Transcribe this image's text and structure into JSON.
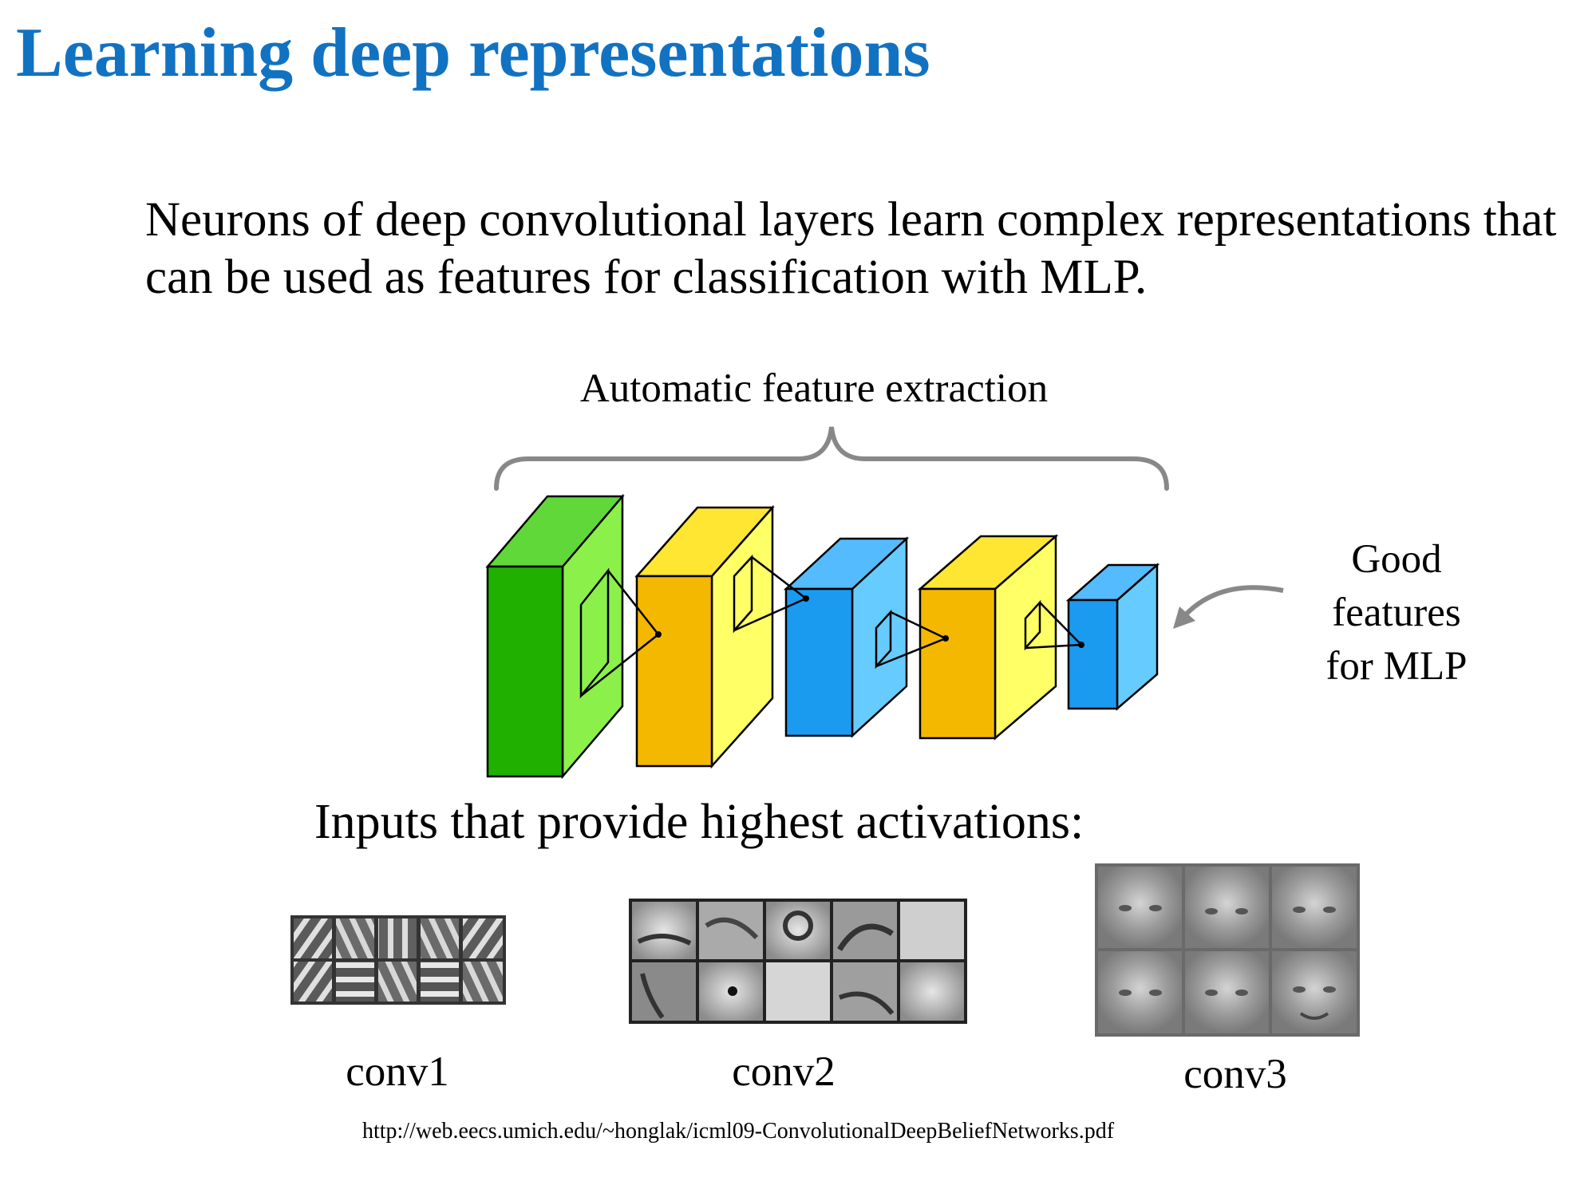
{
  "slide": {
    "title": "Learning deep representations",
    "intro": "Neurons of deep convolutional layers learn complex representations that can be used as features for classification with MLP."
  },
  "diagram": {
    "brace_label": "Automatic feature extraction",
    "good_features_lines": [
      "Good",
      "features",
      "for MLP"
    ],
    "layer_colors": [
      "#1fb000",
      "#f5b800",
      "#1a9bf0",
      "#f5b800",
      "#1a9bf0"
    ],
    "brace_color": "#888888",
    "arrow_color": "#888888"
  },
  "activations": {
    "heading": "Inputs that provide highest activations:",
    "panels": [
      {
        "label": "conv1",
        "rows": 2,
        "cols": 5
      },
      {
        "label": "conv2",
        "rows": 2,
        "cols": 5
      },
      {
        "label": "conv3",
        "rows": 2,
        "cols": 3
      }
    ]
  },
  "source_url": "http://web.eecs.umich.edu/~honglak/icml09-ConvolutionalDeepBeliefNetworks.pdf"
}
